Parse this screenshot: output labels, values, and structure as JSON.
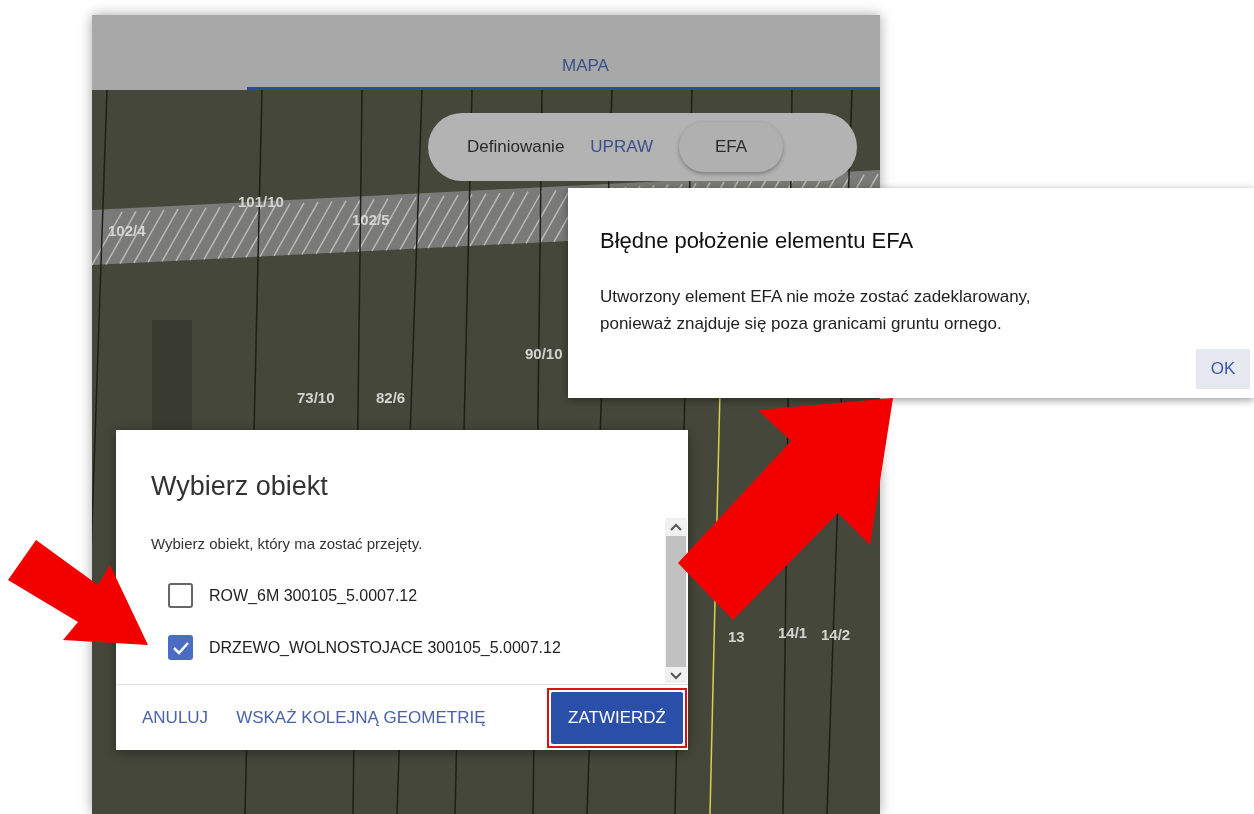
{
  "tabs": [
    {
      "label": "MAPA",
      "selected": true
    }
  ],
  "map": {
    "parcel_labels": [
      {
        "text": "101/10"
      },
      {
        "text": "102/5"
      },
      {
        "text": "102/4"
      },
      {
        "text": "90/10"
      },
      {
        "text": "73/10"
      },
      {
        "text": "82/6"
      },
      {
        "text": "13"
      },
      {
        "text": "14/1"
      },
      {
        "text": "14/2"
      }
    ]
  },
  "mode_toggle": {
    "label": "Definiowanie",
    "options": [
      {
        "label": "UPRAW",
        "selected": false
      },
      {
        "label": "EFA",
        "selected": true
      }
    ]
  },
  "error_dialog": {
    "title": "Błędne położenie elementu EFA",
    "message": "Utworzony element EFA nie może zostać zadeklarowany, ponieważ znajduje się poza granicami gruntu ornego.",
    "button": "OK"
  },
  "select_dialog": {
    "title": "Wybierz obiekt",
    "subtitle": "Wybierz obiekt, który ma zostać przejęty.",
    "items": [
      {
        "label": "ROW_6M 300105_5.0007.12",
        "checked": false
      },
      {
        "label": "DRZEWO_WOLNOSTOJACE 300105_5.0007.12",
        "checked": true
      }
    ],
    "buttons": [
      {
        "label": "ANULUJ",
        "kind": "text"
      },
      {
        "label": "WSKAŻ KOLEJNĄ GEOMETRIĘ",
        "kind": "text"
      },
      {
        "label": "ZATWIERDŹ",
        "kind": "primary",
        "highlighted": true
      }
    ]
  }
}
